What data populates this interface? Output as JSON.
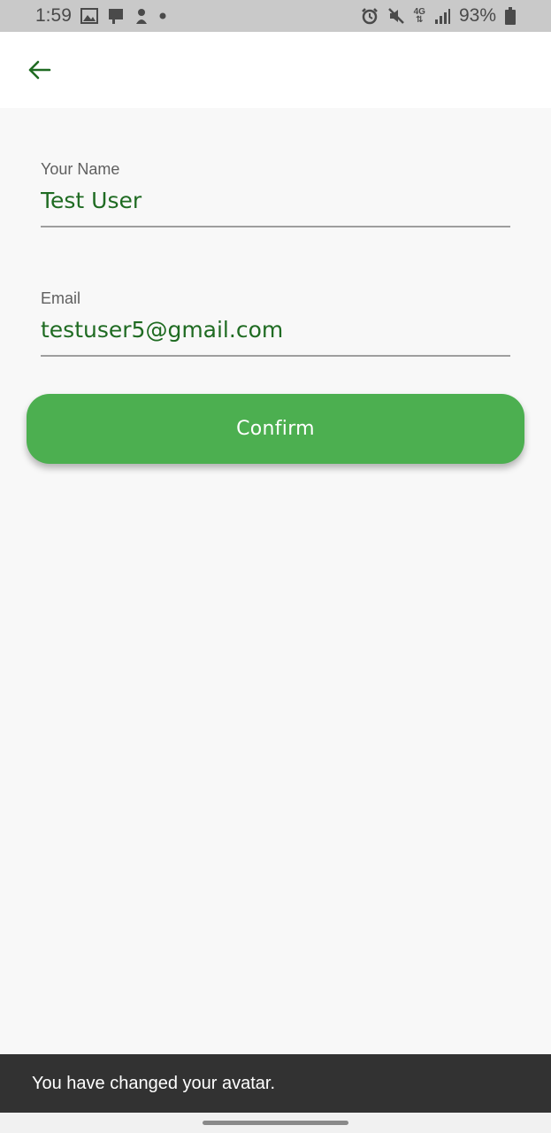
{
  "status_bar": {
    "time": "1:59",
    "battery": "93%",
    "network": "4G",
    "left_icons": [
      "image-icon",
      "cast-icon",
      "app-notification-icon",
      "dot-icon"
    ],
    "right_icons": [
      "alarm-icon",
      "mute-icon",
      "network-4g-icon",
      "signal-icon",
      "battery-icon"
    ]
  },
  "app_bar": {
    "back_icon": "arrow-left-icon",
    "accent_color": "#1f6b22"
  },
  "form": {
    "name": {
      "label": "Your Name",
      "value": "Test User"
    },
    "email": {
      "label": "Email",
      "value": "testuser5@gmail.com"
    },
    "confirm_label": "Confirm",
    "button_color": "#4caf50"
  },
  "snackbar": {
    "message": "You have changed your avatar."
  }
}
